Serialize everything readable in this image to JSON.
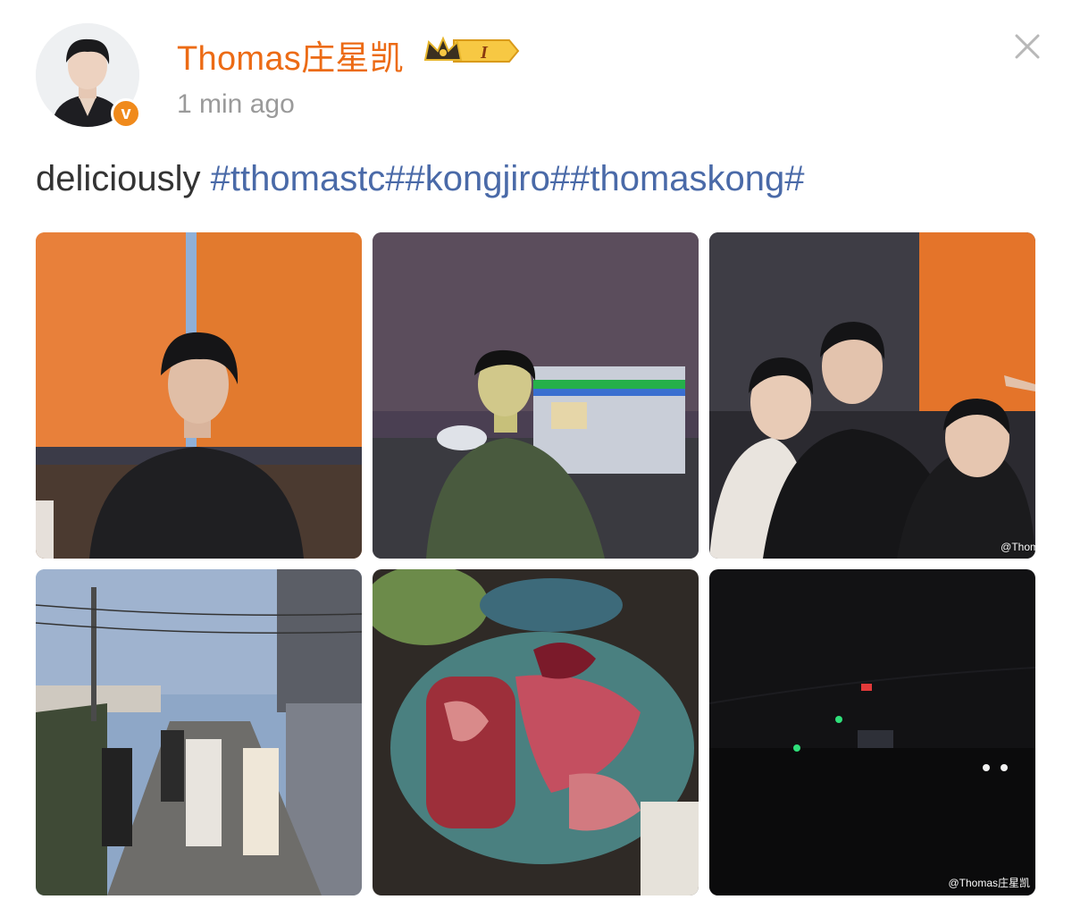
{
  "post": {
    "author": "Thomas庄星凯",
    "badge_text": "I",
    "timestamp": "1 min ago",
    "text_prefix": "deliciously ",
    "hashtags": "#tthomastc##kongjiro##thomaskong#",
    "verified_mark": "v"
  },
  "photos": {
    "watermark_3": "@Thom",
    "watermark_6": "@Thomas庄星凯"
  },
  "icons": [
    "avatar",
    "verified-icon",
    "crown-badge-icon",
    "close-icon"
  ],
  "colors": {
    "username": "#ec6b15",
    "hashtag": "#4a6aa8",
    "timestamp": "#9a9a9a",
    "verified": "#f08a1c"
  }
}
